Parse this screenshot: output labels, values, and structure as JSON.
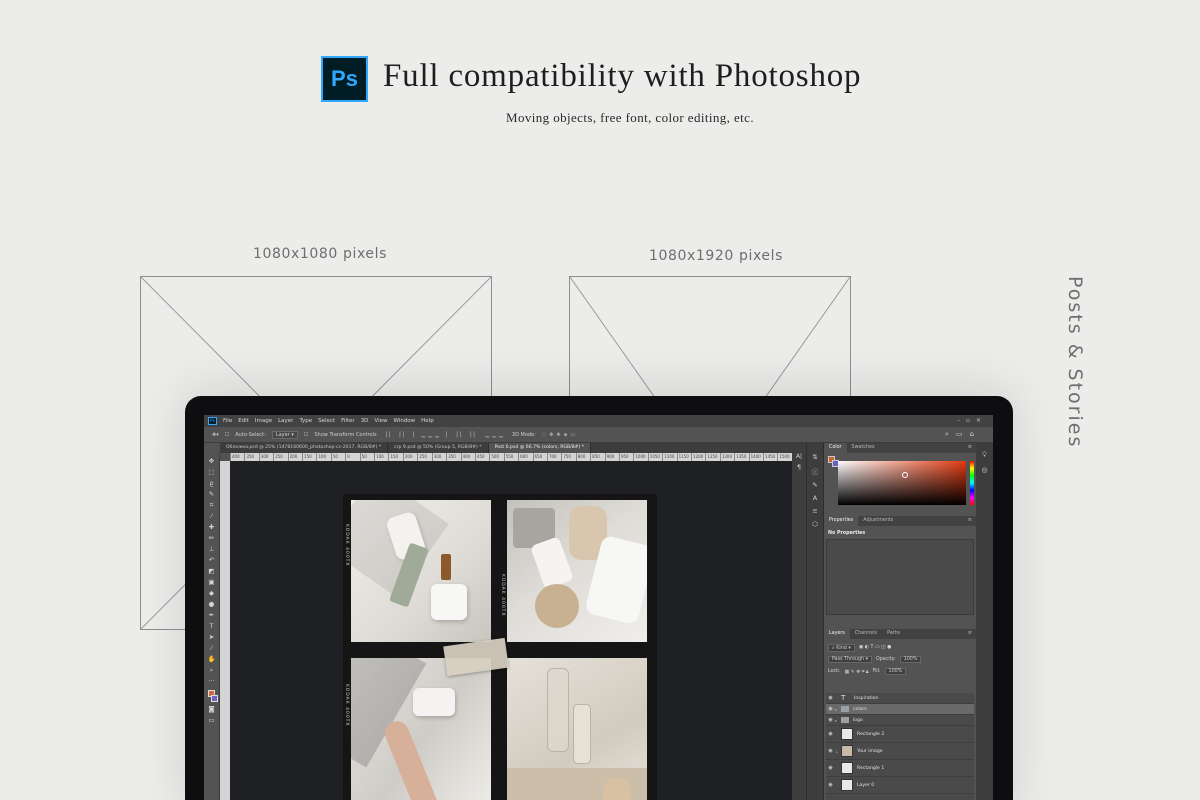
{
  "hero": {
    "logo_text": "Ps",
    "title": "Full compatibility with Photoshop",
    "subtitle": "Moving objects, free font, color editing, etc."
  },
  "formats": [
    {
      "label": "1080x1080 pixels"
    },
    {
      "label": "1080x1920 pixels"
    }
  ],
  "side_label": "Posts & Stories",
  "photoshop": {
    "menu": [
      "File",
      "Edit",
      "Image",
      "Layer",
      "Type",
      "Select",
      "Filter",
      "3D",
      "View",
      "Window",
      "Help"
    ],
    "options": {
      "auto_select": "Auto-Select:",
      "layer_dropdown": "Layer",
      "show_transform": "Show Transform Controls",
      "mode_3d": "3D Mode:"
    },
    "tabs": [
      {
        "label": "Обложка.psd @ 25% (1478160600_photoshop-cc-2017, RGB/8#) *"
      },
      {
        "label": "crp 9.psd @ 50% (Group 5, RGB/8#) *"
      },
      {
        "label": "Post 6.psd @ 66.7% (colors, RGB/8#) *"
      }
    ],
    "ruler_ticks": [
      "400",
      "350",
      "300",
      "250",
      "200",
      "150",
      "100",
      "50",
      "0",
      "50",
      "100",
      "150",
      "200",
      "250",
      "300",
      "350",
      "400",
      "450",
      "500",
      "550",
      "600",
      "650",
      "700",
      "750",
      "800",
      "850",
      "900",
      "950",
      "1000",
      "1050",
      "1100",
      "1150",
      "1200",
      "1250",
      "1300",
      "1350",
      "1400",
      "1450",
      "1500"
    ],
    "film_labels": [
      "KODAK 400TX",
      "KODAK 400TX",
      "KODAK 400TX"
    ],
    "panels": {
      "color_tabs": [
        "Color",
        "Swatches"
      ],
      "properties_tabs": [
        "Properties",
        "Adjustments"
      ],
      "properties_empty": "No Properties",
      "layers_tabs": [
        "Layers",
        "Channels",
        "Paths"
      ],
      "kind_label": "Kind",
      "blend_mode": "Pass Through",
      "opacity_label": "Opacity:",
      "opacity_value": "100%",
      "lock_label": "Lock:",
      "fill_label": "Fill:",
      "fill_value": "100%"
    },
    "layers": [
      {
        "name": "Inspiration",
        "kind": "text"
      },
      {
        "name": "colors",
        "kind": "group",
        "selected": true
      },
      {
        "name": "logo",
        "kind": "group"
      },
      {
        "name": "Rectangle 2",
        "kind": "smart"
      },
      {
        "name": "Your image",
        "kind": "image"
      },
      {
        "name": "Rectangle 1",
        "kind": "smart"
      },
      {
        "name": "Layer 0",
        "kind": "smart"
      }
    ],
    "colors": {
      "foreground": "#c8642e",
      "background": "#6a60c0",
      "accent": "#31a8ff"
    }
  }
}
